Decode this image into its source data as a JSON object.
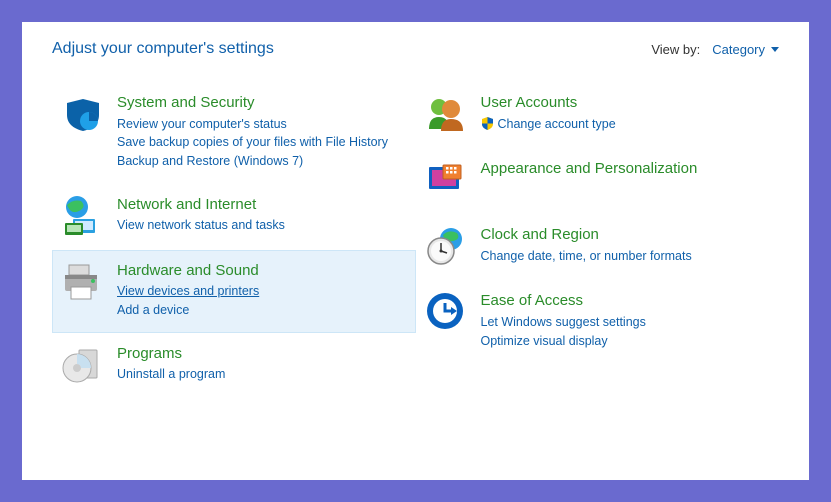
{
  "header": {
    "title": "Adjust your computer's settings",
    "viewby_label": "View by:",
    "viewby_value": "Category"
  },
  "left": [
    {
      "id": "system-security",
      "title": "System and Security",
      "links": [
        "Review your computer's status",
        "Save backup copies of your files with File History",
        "Backup and Restore (Windows 7)"
      ]
    },
    {
      "id": "network-internet",
      "title": "Network and Internet",
      "links": [
        "View network status and tasks"
      ]
    },
    {
      "id": "hardware-sound",
      "title": "Hardware and Sound",
      "links": [
        "View devices and printers",
        "Add a device"
      ],
      "hovered": true,
      "underlined_link": 0
    },
    {
      "id": "programs",
      "title": "Programs",
      "links": [
        "Uninstall a program"
      ]
    }
  ],
  "right": [
    {
      "id": "user-accounts",
      "title": "User Accounts",
      "links": [
        "Change account type"
      ],
      "link_icon": "shield"
    },
    {
      "id": "appearance",
      "title": "Appearance and Personalization",
      "links": []
    },
    {
      "id": "clock-region",
      "title": "Clock and Region",
      "links": [
        "Change date, time, or number formats"
      ]
    },
    {
      "id": "ease-access",
      "title": "Ease of Access",
      "links": [
        "Let Windows suggest settings",
        "Optimize visual display"
      ]
    }
  ]
}
